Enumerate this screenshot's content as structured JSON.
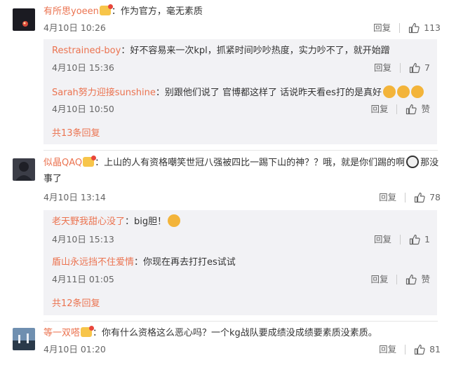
{
  "comments": [
    {
      "username": "有所思yoeen",
      "text": "作为官方，毫无素质",
      "time": "4月10日 10:26",
      "reply_label": "回复",
      "likes": "113",
      "replies": [
        {
          "username": "Restrained-boy",
          "text": "好不容易来一次kpl，抓紧时间吵吵热度，实力吵不了，就开始蹭",
          "time": "4月10日 15:36",
          "reply_label": "回复",
          "likes": "7"
        },
        {
          "username": "Sarah努力迎接sunshine",
          "text": "别跟他们说了 官博都这样了 话说昨天看es打的是真好",
          "time": "4月10日 10:50",
          "reply_label": "回复",
          "likes": "赞"
        }
      ],
      "more": "共13条回复"
    },
    {
      "username": "似晶QAQ",
      "text_line1": "上山的人有资格嘲笑世冠八强被四比一踢下山的神？？哦，就是你们踢的啊",
      "text_line1_tail": "那没",
      "text_line2": "事了",
      "time": "4月10日 13:14",
      "reply_label": "回复",
      "likes": "78",
      "replies": [
        {
          "username": "老天野我甜心没了",
          "text": "big胆！",
          "time": "4月10日 15:13",
          "reply_label": "回复",
          "likes": "1"
        },
        {
          "username": "盾山永远挡不住爱情",
          "text": "你现在再去打打es试试",
          "time": "4月11日 01:05",
          "reply_label": "回复",
          "likes": "赞"
        }
      ],
      "more": "共12条回复"
    },
    {
      "username": "等一双嗒",
      "text": "你有什么资格这么恶心吗？一个kg战队要成绩没成绩要素质没素质。",
      "time": "4月10日 01:20",
      "reply_label": "回复",
      "likes": "81"
    }
  ],
  "colors": {
    "username": "#eb7350",
    "sub_background": "#f2f2f5",
    "text": "#333333",
    "meta": "#666666"
  }
}
